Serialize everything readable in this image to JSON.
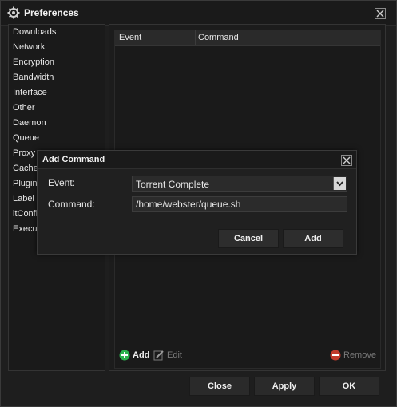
{
  "window": {
    "title": "Preferences"
  },
  "sidebar": {
    "items": [
      {
        "label": "Downloads"
      },
      {
        "label": "Network"
      },
      {
        "label": "Encryption"
      },
      {
        "label": "Bandwidth"
      },
      {
        "label": "Interface"
      },
      {
        "label": "Other"
      },
      {
        "label": "Daemon"
      },
      {
        "label": "Queue"
      },
      {
        "label": "Proxy"
      },
      {
        "label": "Cache"
      },
      {
        "label": "Plugins"
      },
      {
        "label": "Label"
      },
      {
        "label": "ltConfig"
      },
      {
        "label": "Execute"
      }
    ]
  },
  "table": {
    "columns": [
      "Event",
      "Command"
    ],
    "rows": []
  },
  "table_actions": {
    "add": "Add",
    "edit": "Edit",
    "remove": "Remove"
  },
  "buttons": {
    "close": "Close",
    "apply": "Apply",
    "ok": "OK"
  },
  "dialog": {
    "title": "Add Command",
    "event_label": "Event:",
    "event_value": "Torrent Complete",
    "command_label": "Command:",
    "command_value": "/home/webster/queue.sh",
    "cancel": "Cancel",
    "add": "Add"
  },
  "colors": {
    "background": "#1e1e1e",
    "add_icon": "#2bb24c",
    "remove_icon": "#c03a2b",
    "disabled_text": "#7a7a7a"
  }
}
